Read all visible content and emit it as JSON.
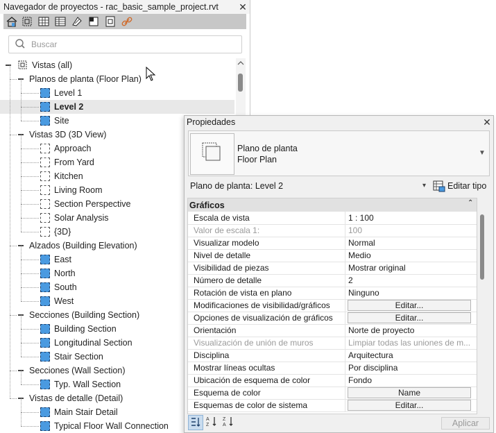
{
  "browser": {
    "title": "Navegador de proyectos - rac_basic_sample_project.rvt",
    "close_icon": "close-icon",
    "toolbar_icons": [
      "home-icon",
      "zoom-extents-icon",
      "grid-icon",
      "table-icon",
      "sheet-icon",
      "view-icon",
      "copy-icon",
      "link-icon"
    ],
    "search_placeholder": "Buscar"
  },
  "tree": {
    "root": "Vistas (all)",
    "groups": [
      {
        "label": "Planos de planta (Floor Plan)",
        "items": [
          {
            "label": "Level 1",
            "icon": "blue"
          },
          {
            "label": "Level 2",
            "icon": "blue",
            "selected": true
          },
          {
            "label": "Site",
            "icon": "blue"
          }
        ]
      },
      {
        "label": "Vistas 3D (3D View)",
        "items": [
          {
            "label": "Approach",
            "icon": "white"
          },
          {
            "label": "From Yard",
            "icon": "white"
          },
          {
            "label": "Kitchen",
            "icon": "white"
          },
          {
            "label": "Living Room",
            "icon": "white"
          },
          {
            "label": "Section Perspective",
            "icon": "white"
          },
          {
            "label": "Solar Analysis",
            "icon": "white"
          },
          {
            "label": "{3D}",
            "icon": "white"
          }
        ]
      },
      {
        "label": "Alzados (Building Elevation)",
        "items": [
          {
            "label": "East",
            "icon": "blue"
          },
          {
            "label": "North",
            "icon": "blue"
          },
          {
            "label": "South",
            "icon": "blue"
          },
          {
            "label": "West",
            "icon": "blue"
          }
        ]
      },
      {
        "label": "Secciones (Building Section)",
        "items": [
          {
            "label": "Building Section",
            "icon": "blue"
          },
          {
            "label": "Longitudinal Section",
            "icon": "blue"
          },
          {
            "label": "Stair Section",
            "icon": "blue"
          }
        ]
      },
      {
        "label": "Secciones (Wall Section)",
        "items": [
          {
            "label": "Typ. Wall Section",
            "icon": "blue"
          }
        ]
      },
      {
        "label": "Vistas de detalle (Detail)",
        "items": [
          {
            "label": "Main Stair Detail",
            "icon": "blue"
          },
          {
            "label": "Typical Floor Wall Connection",
            "icon": "blue"
          }
        ]
      }
    ]
  },
  "props": {
    "title": "Propiedades",
    "type_name_1": "Plano de planta",
    "type_name_2": "Floor Plan",
    "instance_select": "Plano de planta: Level 2",
    "edit_type": "Editar tipo",
    "group": "Gráficos",
    "rows": [
      {
        "name": "Escala de vista",
        "value": "1 : 100"
      },
      {
        "name": "Valor de escala    1:",
        "value": "100",
        "grey": true
      },
      {
        "name": "Visualizar modelo",
        "value": "Normal"
      },
      {
        "name": "Nivel de detalle",
        "value": "Medio"
      },
      {
        "name": "Visibilidad de piezas",
        "value": "Mostrar original"
      },
      {
        "name": "Número de detalle",
        "value": "2"
      },
      {
        "name": "Rotación de vista en plano",
        "value": "Ninguno"
      },
      {
        "name": "Modificaciones de visibilidad/gráficos",
        "button": "Editar..."
      },
      {
        "name": "Opciones de visualización de gráficos",
        "button": "Editar..."
      },
      {
        "name": "Orientación",
        "value": "Norte de proyecto"
      },
      {
        "name": "Visualización de unión de muros",
        "value": "Limpiar todas las uniones de m...",
        "grey": true
      },
      {
        "name": "Disciplina",
        "value": "Arquitectura"
      },
      {
        "name": "Mostrar líneas ocultas",
        "value": "Por disciplina"
      },
      {
        "name": "Ubicación de esquema de color",
        "value": "Fondo"
      },
      {
        "name": "Esquema de color",
        "button": "Name"
      },
      {
        "name": "Esquemas de color de sistema",
        "button": "Editar..."
      }
    ],
    "apply": "Aplicar"
  }
}
